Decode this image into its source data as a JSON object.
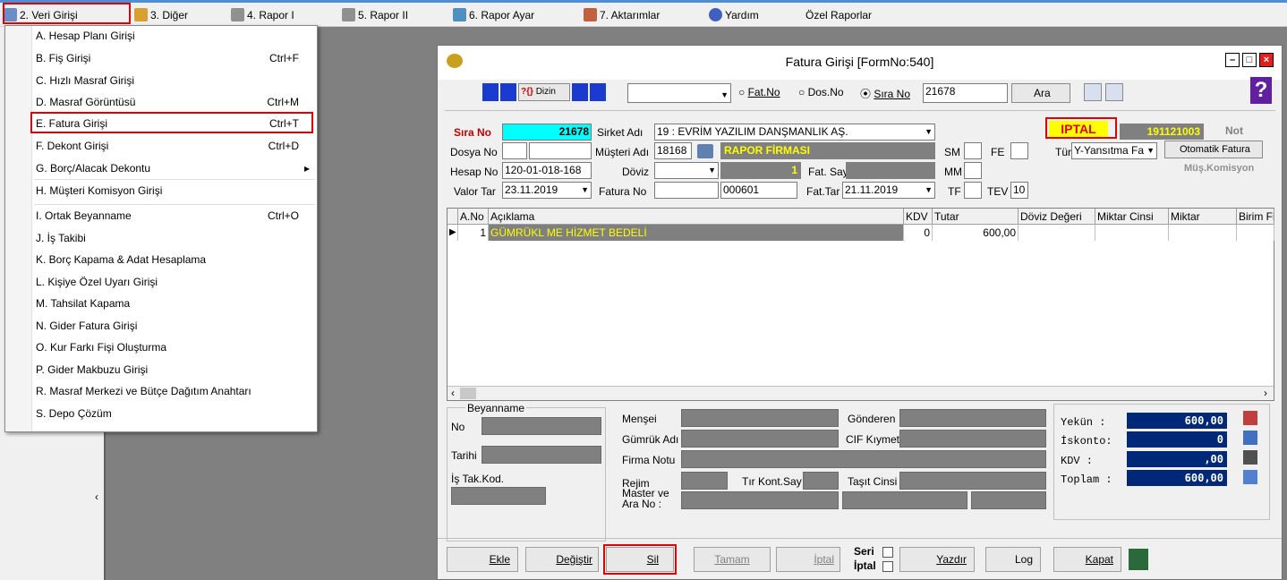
{
  "menubar": {
    "items": [
      {
        "label": "2. Veri Girişi"
      },
      {
        "label": "3. Diğer"
      },
      {
        "label": "4. Rapor I"
      },
      {
        "label": "5. Rapor II"
      },
      {
        "label": "6. Rapor Ayar"
      },
      {
        "label": "7. Aktarımlar"
      },
      {
        "label": "Yardım"
      },
      {
        "label": "Özel Raporlar"
      }
    ]
  },
  "dropdown": {
    "items": [
      {
        "label": "A. Hesap Planı Girişi",
        "shortcut": ""
      },
      {
        "label": "B. Fiş Girişi",
        "shortcut": "Ctrl+F"
      },
      {
        "label": "C. Hızlı Masraf Girişi",
        "shortcut": ""
      },
      {
        "label": "D. Masraf Görüntüsü",
        "shortcut": "Ctrl+M"
      },
      {
        "label": "E. Fatura Girişi",
        "shortcut": "Ctrl+T"
      },
      {
        "label": "F. Dekont Girişi",
        "shortcut": "Ctrl+D"
      },
      {
        "label": "G. Borç/Alacak Dekontu",
        "shortcut": ""
      },
      {
        "label": "H. Müşteri Komisyon Girişi",
        "shortcut": ""
      },
      {
        "label": "I. Ortak Beyanname",
        "shortcut": "Ctrl+O"
      },
      {
        "label": "J. İş Takibi",
        "shortcut": ""
      },
      {
        "label": "K. Borç Kapama & Adat Hesaplama",
        "shortcut": ""
      },
      {
        "label": "L. Kişiye Özel Uyarı Girişi",
        "shortcut": ""
      },
      {
        "label": "M. Tahsilat Kapama",
        "shortcut": ""
      },
      {
        "label": "N. Gider Fatura Girişi",
        "shortcut": ""
      },
      {
        "label": "O. Kur Farkı Fişi Oluşturma",
        "shortcut": ""
      },
      {
        "label": "P. Gider Makbuzu Girişi",
        "shortcut": ""
      },
      {
        "label": "R. Masraf Merkezi ve Bütçe Dağıtım Anahtarı",
        "shortcut": ""
      },
      {
        "label": "S. Depo Çözüm",
        "shortcut": ""
      }
    ]
  },
  "window": {
    "title": "Fatura Girişi [FormNo:540]"
  },
  "toolbar": {
    "dizin": "Dizin",
    "search_value": "21678",
    "radio_fatno": "Fat.No",
    "radio_dosno": "Dos.No",
    "radio_sirano": "Sıra No",
    "ara": "Ara",
    "help": "?"
  },
  "form": {
    "sira_no_label": "Sıra No",
    "sira_no": "21678",
    "sirket_label": "Sirket Adı",
    "sirket": "19 : EVRİM YAZILIM DANŞMANLIK AŞ.",
    "iptal": "IPTAL",
    "doc_no": "191121003",
    "not_label": "Not",
    "dosya_label": "Dosya No",
    "musteri_label": "Müşteri Adı",
    "musteri_kod": "18168",
    "musteri_ad": "RAPOR FİRMASI",
    "sm_label": "SM",
    "fe_label": "FE",
    "tur_label": "Tür",
    "tur": "Y-Yansıtma Fa",
    "otomatik": "Otomatik Fatura",
    "mus_komisyon": "Müş.Komisyon",
    "hesap_label": "Hesap No",
    "hesap": "120-01-018-168",
    "doviz_label": "Döviz",
    "kur": "1",
    "fatsay_label": "Fat. Say",
    "mm_label": "MM",
    "valor_label": "Valor Tar",
    "valor": "23.11.2019",
    "faturano_label": "Fatura No",
    "faturano": "000601",
    "fattar_label": "Fat.Tar",
    "fattar": "21.11.2019",
    "tf_label": "TF",
    "tev_label": "TEV",
    "tev": "10"
  },
  "grid": {
    "columns": [
      "A.No",
      "Açıklama",
      "KDV",
      "Tutar",
      "Döviz Değeri",
      "Miktar Cinsi",
      "Miktar",
      "Birim Fiya"
    ],
    "rows": [
      {
        "ano": "1",
        "aciklama": "GÜMRÜKL ME HİZMET BEDELİ",
        "kdv": "0",
        "tutar": "600,00"
      }
    ]
  },
  "bottom": {
    "beyanname": "Beyanname",
    "no": "No",
    "tarihi": "Tarihi",
    "istak": "İş Tak.Kod.",
    "mensei": "Menşei",
    "gumruk": "Gümrük Adı",
    "firmanotu": "Firma Notu",
    "rejim": "Rejim",
    "master": "Master ve Ara No :",
    "tirkont": "Tır Kont.Say",
    "gonderen": "Gönderen",
    "cif": "CIF Kıymet",
    "tasit": "Taşıt Cinsi"
  },
  "summary": {
    "yekun_label": "Yekün  :",
    "yekun": "600,00",
    "iskonto_label": "İskonto:",
    "iskonto": "0",
    "kdv_label": "KDV    :",
    "kdv": ",00",
    "toplam_label": "Toplam :",
    "toplam": "600,00"
  },
  "buttons": {
    "ekle": "Ekle",
    "degistir": "Değiştir",
    "sil": "Sil",
    "tamam": "Tamam",
    "iptal": "İptal",
    "seri": "Seri",
    "iptal2": "İptal",
    "yazdir": "Yazdır",
    "log": "Log",
    "kapat": "Kapat"
  }
}
